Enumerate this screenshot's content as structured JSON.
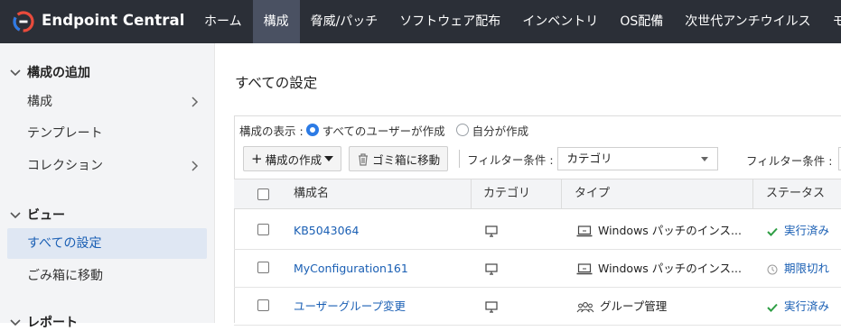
{
  "app": {
    "brand": "Endpoint Central",
    "nav": [
      "ホーム",
      "構成",
      "脅威/パッチ",
      "ソフトウェア配布",
      "インベントリ",
      "OS配備",
      "次世代アンチウイルス",
      "モ"
    ],
    "active_nav": "構成",
    "colors": {
      "topbar": "#2b2f37",
      "active_tab": "#4a5162",
      "link": "#1a5fb4",
      "sidebar_active": "#dfe7f3",
      "success": "#2e9e44"
    }
  },
  "sidebar": {
    "sections": [
      {
        "title": "構成の追加",
        "items": [
          "構成",
          "テンプレート",
          "コレクション"
        ]
      },
      {
        "title": "ビュー",
        "items": [
          "すべての設定",
          "ごみ箱に移動"
        ]
      },
      {
        "title": "レポート"
      }
    ],
    "active_item": "すべての設定"
  },
  "main": {
    "title": "すべての設定",
    "scope_label": "構成の表示 :",
    "scope_options": [
      "すべてのユーザーが作成",
      "自分が作成"
    ],
    "scope_selected": "すべてのユーザーが作成",
    "toolbar": {
      "create_label": "構成の作成",
      "trash_label": "ゴミ箱に移動",
      "filter_label": "フィルター条件 :",
      "filter_value": "カテゴリ",
      "filter2_label": "フィルター条件 :"
    },
    "table": {
      "columns": [
        "構成名",
        "カテゴリ",
        "タイプ",
        "ステータス"
      ],
      "rows": [
        {
          "name": "KB5043064",
          "category_icon": "monitor-icon",
          "type": "Windows パッチのインス...",
          "type_icon": "laptop-icon",
          "status": "実行済み",
          "status_icon": "check-icon"
        },
        {
          "name": "MyConfiguration161",
          "category_icon": "monitor-icon",
          "type": "Windows パッチのインス...",
          "type_icon": "laptop-icon",
          "status": "期限切れ",
          "status_icon": "clock-icon"
        },
        {
          "name": "ユーザーグループ変更",
          "category_icon": "monitor-icon",
          "type": "グループ管理",
          "type_icon": "users-icon",
          "status": "実行済み",
          "status_icon": "check-icon"
        }
      ]
    }
  }
}
